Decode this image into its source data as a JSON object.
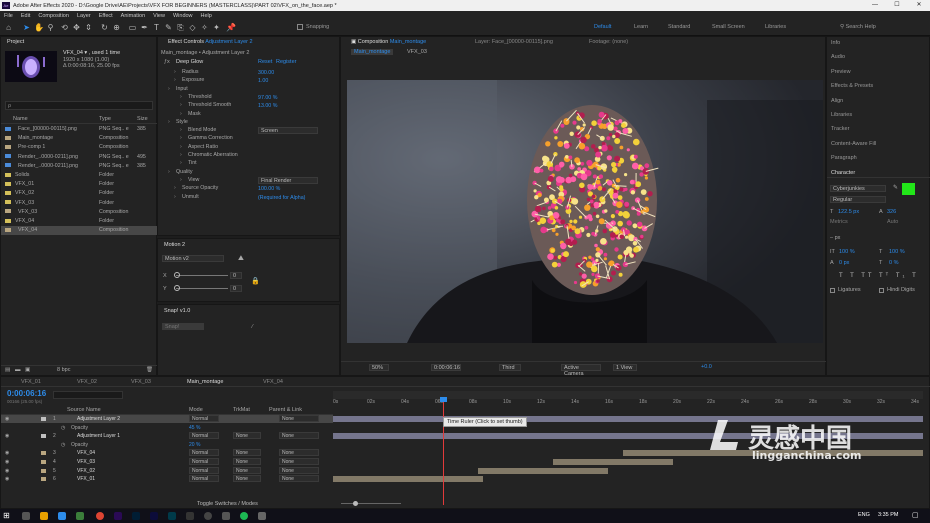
{
  "window": {
    "title": "Adobe After Effects 2020 - D:\\Google Drive\\AE\\Projects\\VFX FOR BEGINNERS (MASTERCLASS)\\PART 02\\VFX_on_the_face.aep *",
    "minimize": "—",
    "maximize": "☐",
    "close": "✕"
  },
  "menu": [
    "File",
    "Edit",
    "Composition",
    "Layer",
    "Effect",
    "Animation",
    "View",
    "Window",
    "Help"
  ],
  "toolbar": {
    "snapping": "Snapping",
    "workspaces": [
      "Default",
      "Learn",
      "Standard",
      "Small Screen",
      "Libraries"
    ],
    "search": "Search Help"
  },
  "project": {
    "tab": "Project",
    "selected_name": "VFX_04 ▾ , used 1 time",
    "info1": "1920 x 1080 (1.00)",
    "info2": "Δ 0:00:08:16, 25.00 fps",
    "search_placeholder": "ρ",
    "headers": {
      "name": "Name",
      "type": "Type",
      "size": "Size"
    },
    "items": [
      {
        "name": "Face_[00000-00115].png",
        "type": "PNG Seq.. e",
        "size": "385",
        "color": "#4b8bd8",
        "sel": false
      },
      {
        "name": "Main_montage",
        "type": "Composition",
        "size": "",
        "color": "#b9a680",
        "sel": false
      },
      {
        "name": "Pre-comp 1",
        "type": "Composition",
        "size": "",
        "color": "#b9a680",
        "sel": false
      },
      {
        "name": "Render_..0000-0211].png",
        "type": "PNG Seq.. e",
        "size": "495",
        "color": "#4b8bd8",
        "sel": false
      },
      {
        "name": "Render_..0000-0211].png",
        "type": "PNG Seq.. e",
        "size": "385",
        "color": "#4b8bd8",
        "sel": false
      },
      {
        "name": "Solids",
        "type": "Folder",
        "size": "",
        "color": "#d4c05a",
        "sel": false
      },
      {
        "name": "VFX_01",
        "type": "Folder",
        "size": "",
        "color": "#d4c05a",
        "sel": false
      },
      {
        "name": "VFX_02",
        "type": "Folder",
        "size": "",
        "color": "#d4c05a",
        "sel": false
      },
      {
        "name": "VFX_03",
        "type": "Folder",
        "size": "",
        "color": "#d4c05a",
        "sel": false
      },
      {
        "name": "VFX_03",
        "type": "Composition",
        "size": "",
        "color": "#b9a680",
        "sel": false
      },
      {
        "name": "VFX_04",
        "type": "Folder",
        "size": "",
        "color": "#d4c05a",
        "sel": false
      },
      {
        "name": "VFX_04",
        "type": "Composition",
        "size": "",
        "color": "#b9a680",
        "sel": true
      }
    ],
    "bpc": "8 bpc"
  },
  "effects": {
    "tab": "Effect Controls",
    "layer": "Adjustment Layer 2",
    "header": "Main_montage • Adjustment Layer 2",
    "fx": "Deep Glow",
    "reset": "Reset",
    "register": "Register",
    "props": [
      {
        "label": "Radius",
        "value": "300.00",
        "indent": 2
      },
      {
        "label": "Exposure",
        "value": "1.00",
        "indent": 2
      },
      {
        "label": "Input",
        "value": "",
        "indent": 1
      },
      {
        "label": "Threshold",
        "value": "97.00 %",
        "indent": 3
      },
      {
        "label": "Threshold Smooth",
        "value": "13.00 %",
        "indent": 3
      },
      {
        "label": "Mask",
        "value": "",
        "indent": 3
      },
      {
        "label": "Style",
        "value": "",
        "indent": 1
      },
      {
        "label": "Blend Mode",
        "value": "Screen",
        "indent": 3
      },
      {
        "label": "Gamma Correction",
        "value": "",
        "indent": 3
      },
      {
        "label": "Aspect Ratio",
        "value": "",
        "indent": 3
      },
      {
        "label": "Chromatic Aberration",
        "value": "",
        "indent": 3
      },
      {
        "label": "Tint",
        "value": "",
        "indent": 3
      },
      {
        "label": "Quality",
        "value": "",
        "indent": 1
      },
      {
        "label": "View",
        "value": "Final Render",
        "indent": 3
      },
      {
        "label": "Source Opacity",
        "value": "100.00 %",
        "indent": 2
      },
      {
        "label": "Unmult",
        "value": "(Required for Alpha)",
        "indent": 2
      }
    ]
  },
  "motion": {
    "tab": "Motion 2",
    "preset": "Motion v2",
    "rows": [
      {
        "l": "X",
        "v": "0"
      },
      {
        "l": "Y",
        "v": "0"
      }
    ]
  },
  "snap": {
    "tab": "Snap! v1.0",
    "btn": "Snap!"
  },
  "composition": {
    "tab_prefix": "Composition",
    "tab_name": "Main_montage",
    "layer_tab": "Layer: Face_[00000-00115].png",
    "footage_tab": "Footage: (none)",
    "nav1": "Main_montage",
    "nav2": "VFX_03",
    "zoom": "50%",
    "time": "0:00:06:16",
    "res": "Third",
    "camera": "Active Camera",
    "views": "1 View",
    "exposure": "+0.0"
  },
  "right_panel": {
    "items": [
      "Info",
      "Audio",
      "Preview",
      "Effects & Presets",
      "Align",
      "Libraries",
      "Tracker",
      "Content-Aware Fill",
      "Paragraph",
      "Character"
    ],
    "font": "Cyberjunkies",
    "style": "Regular",
    "size": "122.5 px",
    "leading": "Auto",
    "kern": "Metrics",
    "track": "326",
    "vscale": "100 %",
    "hscale": "100 %",
    "baseline": "0 px",
    "tsume": "0 %",
    "ligatures": "Ligatures",
    "hindi": "Hindi Digits",
    "fill_color": "#22e619",
    "stroke_units": "– px"
  },
  "timeline": {
    "tabs": [
      "VFX_01",
      "VFX_02",
      "VFX_03",
      "Main_montage",
      "VFX_04"
    ],
    "active_tab": "Main_montage",
    "time": "0:00:06:16",
    "frames": "00166 (25.00 fps)",
    "headers": {
      "name": "Source Name",
      "mode": "Mode",
      "trkmat": "TrkMat",
      "parent": "Parent & Link"
    },
    "layers": [
      {
        "num": "1",
        "name": "Adjustment Layer 2",
        "mode": "Normal",
        "trk": "",
        "parent": "None",
        "sel": true,
        "color": "#c0c0c0"
      },
      {
        "num": "",
        "name": "Opacity",
        "mode": "45 %",
        "trk": "",
        "parent": "",
        "sel": false,
        "prop": true
      },
      {
        "num": "2",
        "name": "Adjustment Layer 1",
        "mode": "Normal",
        "trk": "None",
        "parent": "None",
        "sel": false,
        "color": "#c0c0c0"
      },
      {
        "num": "",
        "name": "Opacity",
        "mode": "20 %",
        "trk": "",
        "parent": "",
        "sel": false,
        "prop": true
      },
      {
        "num": "3",
        "name": "VFX_04",
        "mode": "Normal",
        "trk": "None",
        "parent": "None",
        "sel": false,
        "color": "#b9a680"
      },
      {
        "num": "4",
        "name": "VFX_03",
        "mode": "Normal",
        "trk": "None",
        "parent": "None",
        "sel": false,
        "color": "#b9a680"
      },
      {
        "num": "5",
        "name": "VFX_02",
        "mode": "Normal",
        "trk": "None",
        "parent": "None",
        "sel": false,
        "color": "#b9a680"
      },
      {
        "num": "6",
        "name": "VFX_01",
        "mode": "Normal",
        "trk": "None",
        "parent": "None",
        "sel": false,
        "color": "#b9a680"
      }
    ],
    "ruler": [
      "0s",
      "02s",
      "04s",
      "06s",
      "08s",
      "10s",
      "12s",
      "14s",
      "16s",
      "18s",
      "20s",
      "22s",
      "24s",
      "26s",
      "28s",
      "30s",
      "32s",
      "34s"
    ],
    "tooltip": "Time Ruler (Click to set thumb)",
    "toggle": "Toggle Switches / Modes"
  },
  "taskbar": {
    "lang": "ENG",
    "clock": "3:35 PM"
  },
  "watermark": {
    "cn": "灵感中国",
    "url": "lingganchina.com"
  }
}
